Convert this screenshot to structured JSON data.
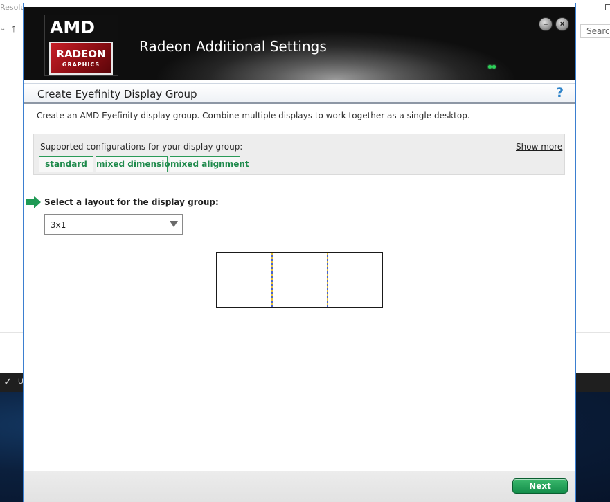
{
  "background": {
    "window_title_fragment": "Resolu",
    "search_placeholder": "Search",
    "taskbar_text": "U"
  },
  "header": {
    "logo_amd": "AMD",
    "logo_radeon": "RADEON",
    "logo_graphics": "GRAPHICS",
    "app_title": "Radeon Additional Settings",
    "minimize_icon": "minimize-icon",
    "close_icon": "close-icon"
  },
  "page": {
    "title": "Create Eyefinity Display Group",
    "help_symbol": "?",
    "description": "Create an AMD Eyefinity display group. Combine multiple displays to work together as a single desktop."
  },
  "configurations": {
    "label": "Supported configurations for your display group:",
    "show_more": "Show more",
    "tags": [
      "standard",
      "mixed dimension",
      "mixed alignment"
    ]
  },
  "layout": {
    "label": "Select a layout for the display group:",
    "selected": "3x1"
  },
  "preview": {
    "columns": 3
  },
  "footer": {
    "next_label": "Next"
  },
  "colors": {
    "accent_green": "#1f8a4c",
    "help_blue": "#2e83c9",
    "amd_red": "#c81f27"
  }
}
